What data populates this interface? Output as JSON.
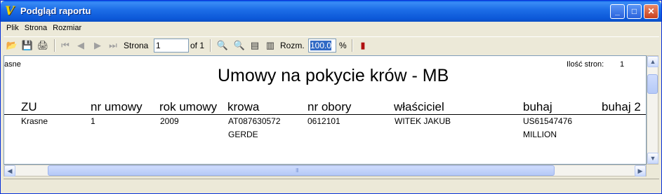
{
  "window": {
    "title": "Podgląd raportu",
    "app_icon_glyph": "V",
    "controls": {
      "minimize": "_",
      "maximize": "□",
      "close": "✕"
    }
  },
  "menu": [
    "Plik",
    "Strona",
    "Rozmiar"
  ],
  "toolbar": {
    "page_label": "Strona",
    "page_value": "1",
    "page_of": "of 1",
    "zoom_label": "Rozm.",
    "zoom_value": "100.0",
    "zoom_unit": "%",
    "icons": {
      "open": "📂",
      "save": "💾",
      "print": "🖨",
      "first": "⏮",
      "prev": "◀",
      "next": "▶",
      "last": "⏭",
      "zoom_in": "🔍",
      "zoom_out": "🔍",
      "page_width": "▤",
      "whole_page": "▥",
      "exit": "▮"
    }
  },
  "report": {
    "corner_text": "asne",
    "page_count_label": "Ilość stron:",
    "page_count_value": "1",
    "title": "Umowy na pokycie krów - MB",
    "columns": [
      "ZU",
      "nr umowy",
      "rok umowy",
      "krowa",
      "nr obory",
      "właściciel",
      "buhaj",
      "buhaj 2"
    ],
    "row": {
      "zu": "Krasne",
      "nr_umowy": "1",
      "rok_umowy": "2009",
      "krowa": "AT087630572",
      "krowa_name": "GERDE",
      "nr_obory": "0612101",
      "wlasciciel": "WITEK JAKUB",
      "buhaj": "US61547476",
      "buhaj_name": "MILLION"
    }
  },
  "scroll": {
    "up": "▲",
    "down": "▼",
    "left": "◀",
    "right": "▶",
    "grip": "III"
  },
  "colors": {
    "title_bar": "#0c58d8",
    "zoom_selection": "#316ac5",
    "window_bg": "#ece9d8"
  }
}
